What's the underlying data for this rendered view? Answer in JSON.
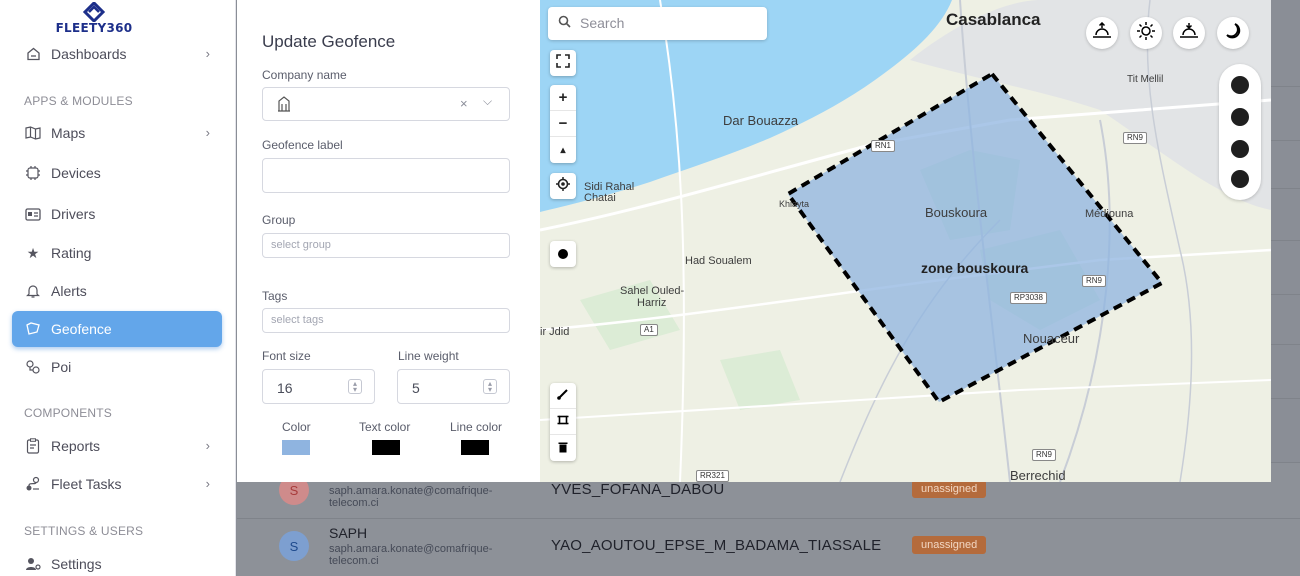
{
  "brand": {
    "logo_text": "FLEETY360"
  },
  "sidebar": {
    "dashboards": "Dashboards",
    "apps_section": "APPS & MODULES",
    "maps": "Maps",
    "devices": "Devices",
    "drivers": "Drivers",
    "rating": "Rating",
    "alerts": "Alerts",
    "geofence": "Geofence",
    "poi": "Poi",
    "components_section": "COMPONENTS",
    "reports": "Reports",
    "fleet_tasks": "Fleet Tasks",
    "settings_section": "SETTINGS & USERS",
    "settings": "Settings"
  },
  "background_table": {
    "rows": [
      {
        "avatar": "S",
        "name": "",
        "email": "saph.amara.konate@comafrique-telecom.ci",
        "driver": "YVES_FOFANA_DABOU",
        "status": "unassigned"
      },
      {
        "avatar": "S",
        "name": "SAPH",
        "email": "saph.amara.konate@comafrique-telecom.ci",
        "driver": "YAO_AOUTOU_EPSE_M_BADAMA_TIASSALE",
        "status": "unassigned"
      }
    ]
  },
  "form": {
    "title": "Update Geofence",
    "company_label": "Company name",
    "geofence_label": "Geofence label",
    "group_label": "Group",
    "group_placeholder": "select group",
    "tags_label": "Tags",
    "tags_placeholder": "select tags",
    "font_size_label": "Font size",
    "font_size_value": "16",
    "line_weight_label": "Line weight",
    "line_weight_value": "5",
    "color_label": "Color",
    "text_color_label": "Text color",
    "line_color_label": "Line color",
    "colors": {
      "fill": "#8fb4e0",
      "text": "#000000",
      "line": "#000000"
    }
  },
  "map": {
    "search_placeholder": "Search",
    "zone_label": "zone bouskoura",
    "places": {
      "casablanca": "Casablanca",
      "dar_bouazza": "Dar Bouazza",
      "tit_mellil": "Tit Mellil",
      "sidi_rahal": "Sidi Rahal",
      "chatai": "Chatai",
      "khiayta": "Khiayta",
      "bouskoura": "Bouskoura",
      "mediouna": "Médiouna",
      "had_soualem": "Had Soualem",
      "sahel": "Sahel Ouled-",
      "harriz": "Harriz",
      "ir_jdid": "ir Jdid",
      "nouaceur": "Nouaceur",
      "berrechid": "Berrechid"
    },
    "roads": {
      "rn1": "RN1",
      "rn9a": "RN9",
      "rn9b": "RN9",
      "rn9c": "RN9",
      "rp3038": "RP3038",
      "a1": "A1",
      "rr321": "RR321"
    }
  }
}
